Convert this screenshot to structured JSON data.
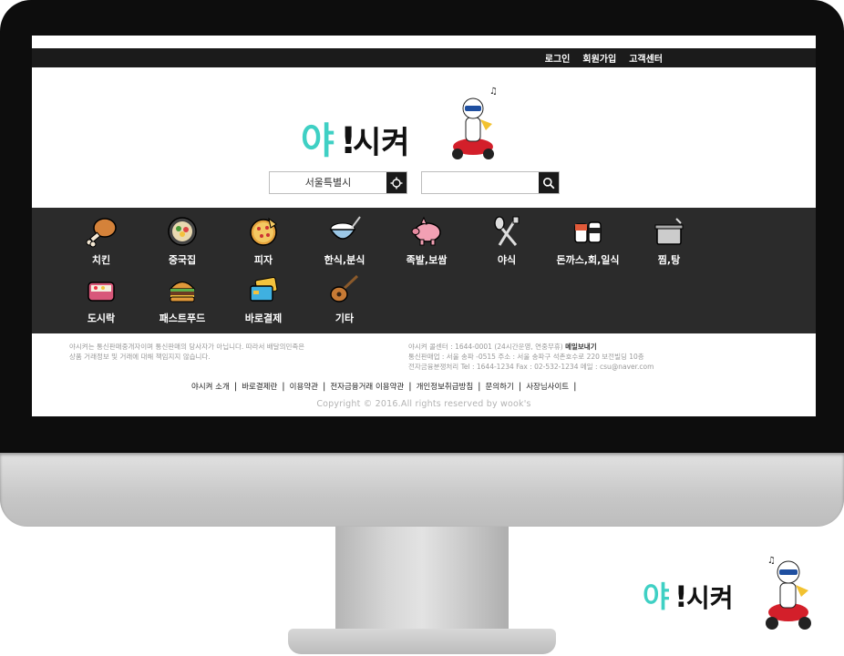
{
  "header": {
    "links": [
      "로그인",
      "회원가입",
      "고객센터"
    ]
  },
  "brand": {
    "logo_text_a": "야",
    "logo_text_b": "!",
    "logo_text_c": "시켜",
    "accent": "#3fd0c4",
    "scooter": "#d31f2a"
  },
  "search": {
    "location_value": "서울특별시",
    "keyword_value": ""
  },
  "categories": [
    {
      "label": "치킨",
      "icon": "chicken-leg-icon"
    },
    {
      "label": "중국집",
      "icon": "bibimbap-bowl-icon"
    },
    {
      "label": "피자",
      "icon": "pizza-icon"
    },
    {
      "label": "한식,분식",
      "icon": "rice-bowl-icon"
    },
    {
      "label": "족발,보쌈",
      "icon": "pig-icon"
    },
    {
      "label": "야식",
      "icon": "spoon-fork-icon"
    },
    {
      "label": "돈까스,회,일식",
      "icon": "sushi-icon"
    },
    {
      "label": "찜,탕",
      "icon": "pot-icon"
    },
    {
      "label": "도시락",
      "icon": "lunchbox-icon"
    },
    {
      "label": "패스트푸드",
      "icon": "burger-icon"
    },
    {
      "label": "바로결제",
      "icon": "card-icon"
    },
    {
      "label": "기타",
      "icon": "guitar-icon"
    }
  ],
  "footer": {
    "notice_1": "야시켜는 통신판매중개자이며 통신판매의 당사자가 아닙니다. 따라서 배달의민족은",
    "notice_2": "상품 거래정보 및 거래에 대해 책임지지 않습니다.",
    "cs_1": "야시켜 콜센터 : 1644-0001 (24시간운영, 연중무휴)",
    "cs_mail": "메일보내기",
    "cs_2": "통신판매업 : 서울 송파 -0515 주소 : 서울 송파구 석촌호수로 220 보전빌딩 10층",
    "cs_3": "전자금융분쟁처리 Tel : 1644-1234 Fax : 02-532-1234 메일 : csu@naver.com",
    "links": [
      "야시켜 소개",
      "바로결제란",
      "이용약관",
      "전자금융거래 이용약관",
      "개인정보취급방침",
      "문의하기",
      "사장님사이트"
    ],
    "copyright": "Copyright © 2016.All rights reserved by wook's"
  }
}
